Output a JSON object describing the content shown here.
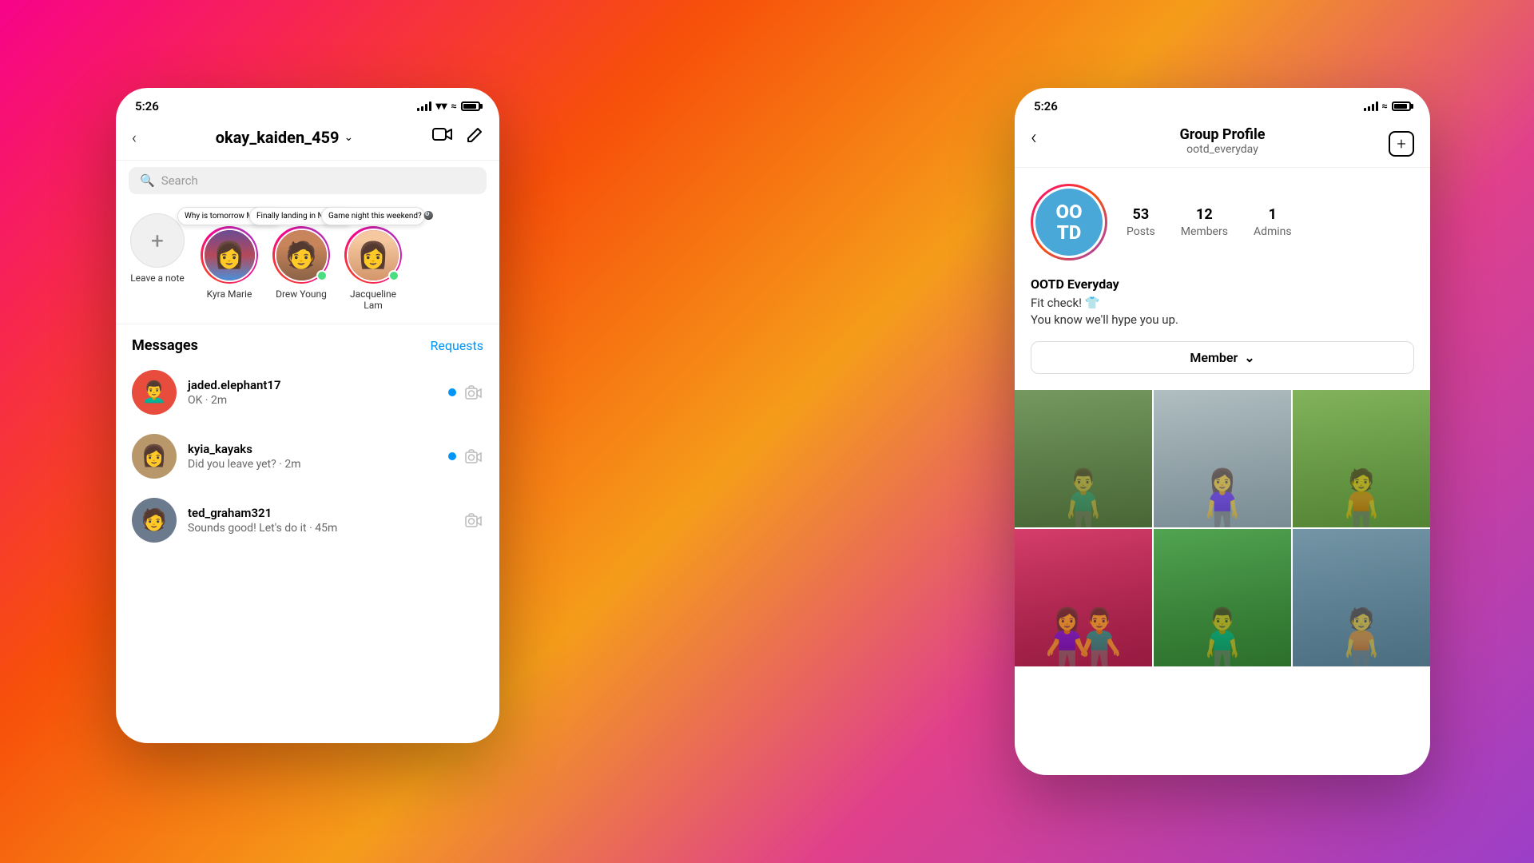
{
  "background": {
    "gradient": "135deg, #f7038a 0%, #f7500a 30%, #f59c1a 50%, #e0408c 70%, #9b3fc8 100%"
  },
  "left_phone": {
    "status_bar": {
      "time": "5:26"
    },
    "header": {
      "username": "okay_kaiden_459",
      "chevron": "∨",
      "video_icon": "video",
      "edit_icon": "edit"
    },
    "stories": [
      {
        "id": "self",
        "label": "Leave a note",
        "has_add": true,
        "note": null,
        "online": false
      },
      {
        "id": "kyra",
        "label": "Kyra Marie",
        "note": "Why is tomorrow Monday!? 😩",
        "online": false,
        "avatar_color": "#c0392b"
      },
      {
        "id": "drew",
        "label": "Drew Young",
        "note": "Finally landing in NYC! ❤️",
        "online": true,
        "avatar_color": "#e67e22"
      },
      {
        "id": "jacqueline",
        "label": "Jacqueline Lam",
        "note": "Game night this weekend? 🎱",
        "online": true,
        "avatar_color": "#8e44ad"
      }
    ],
    "search_placeholder": "Search",
    "messages_title": "Messages",
    "requests_label": "Requests",
    "messages": [
      {
        "username": "jaded.elephant17",
        "preview": "OK · 2m",
        "unread": true,
        "avatar_color": "#c0392b"
      },
      {
        "username": "kyia_kayaks",
        "preview": "Did you leave yet? · 2m",
        "unread": true,
        "avatar_color": "#8e6b4a"
      },
      {
        "username": "ted_graham321",
        "preview": "Sounds good! Let's do it · 45m",
        "unread": false,
        "avatar_color": "#5d6d7e"
      }
    ]
  },
  "right_phone": {
    "status_bar": {
      "time": "5:26"
    },
    "header": {
      "title": "Group Profile",
      "subtitle": "ootd_everyday",
      "back_label": "<",
      "add_label": "+"
    },
    "group": {
      "avatar_text": "OO\nTD",
      "avatar_display": "OO TD",
      "stats": [
        {
          "number": "53",
          "label": "Posts"
        },
        {
          "number": "12",
          "label": "Members"
        },
        {
          "number": "1",
          "label": "Admins"
        }
      ],
      "name": "OOTD Everyday",
      "bio_line1": "Fit check! 👕",
      "bio_line2": "You know we'll hype you up.",
      "member_button": "Member",
      "chevron": "∨"
    },
    "photos": [
      {
        "id": 1,
        "color": "#7a9a6b",
        "person": "🧍"
      },
      {
        "id": 2,
        "color": "#a9b8c0",
        "person": "🧍‍♀️"
      },
      {
        "id": 3,
        "color": "#8faa7c",
        "person": "🧍"
      },
      {
        "id": 4,
        "color": "#c94080",
        "person": "🧍‍♀️"
      },
      {
        "id": 5,
        "color": "#5a8c5a",
        "person": "🧍"
      },
      {
        "id": 6,
        "color": "#6e8490",
        "person": "🧍"
      }
    ]
  }
}
